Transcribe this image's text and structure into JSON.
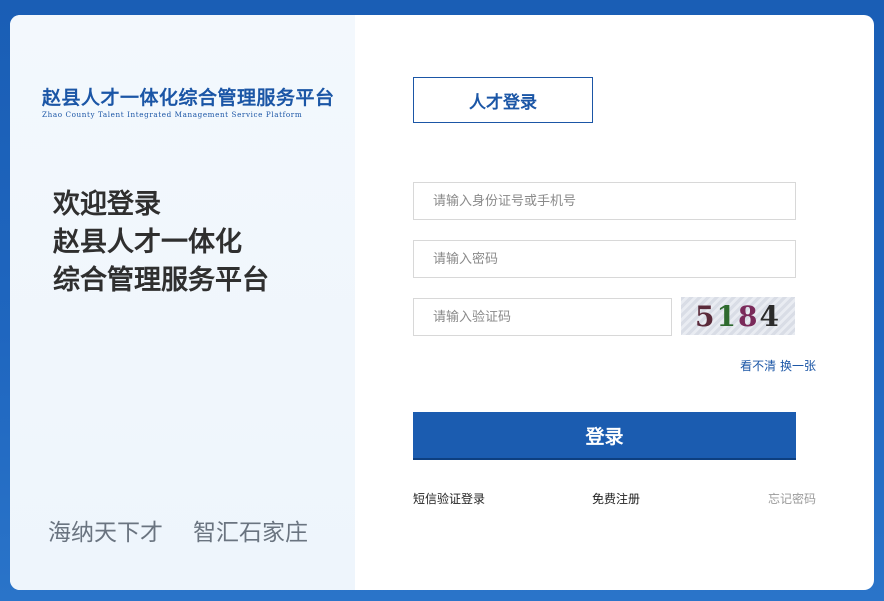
{
  "brand": {
    "logo_cn": "赵县人才一体化综合管理服务平台",
    "logo_en": "Zhao County Talent Integrated Management Service Platform"
  },
  "welcome": {
    "line1": "欢迎登录",
    "line2": "赵县人才一体化",
    "line3": "综合管理服务平台"
  },
  "slogan": {
    "part1": "海纳天下才",
    "part2": "智汇石家庄"
  },
  "login": {
    "tab_label": "人才登录",
    "id_placeholder": "请输入身份证号或手机号",
    "password_placeholder": "请输入密码",
    "captcha_placeholder": "请输入验证码",
    "captcha_digits": [
      "5",
      "1",
      "8",
      "4"
    ],
    "refresh_hint": "看不清",
    "refresh_link": "换一张",
    "submit_label": "登录",
    "sms_login": "短信验证登录",
    "register": "免费注册",
    "forgot": "忘记密码"
  },
  "colors": {
    "primary": "#1b56a6",
    "button": "#1b5cb0",
    "background": "#1a5eb5"
  }
}
